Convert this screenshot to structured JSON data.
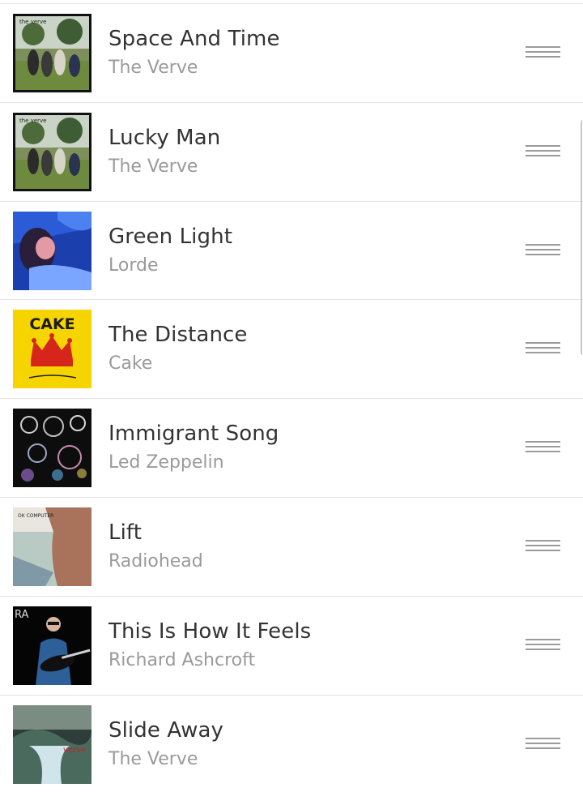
{
  "playlist": {
    "tracks": [
      {
        "title": "Space And Time",
        "artist": "The Verve",
        "cover": "urban-hymns",
        "cover_text": "the verve"
      },
      {
        "title": "Lucky Man",
        "artist": "The Verve",
        "cover": "urban-hymns",
        "cover_text": "the verve"
      },
      {
        "title": "Green Light",
        "artist": "Lorde",
        "cover": "melodrama",
        "cover_text": ""
      },
      {
        "title": "The Distance",
        "artist": "Cake",
        "cover": "fashion-nugget",
        "cover_text": "CAKE"
      },
      {
        "title": "Immigrant Song",
        "artist": "Led Zeppelin",
        "cover": "led-zeppelin-iii",
        "cover_text": ""
      },
      {
        "title": "Lift",
        "artist": "Radiohead",
        "cover": "ok-computer",
        "cover_text": "OK COMPUTER"
      },
      {
        "title": "This Is How It Feels",
        "artist": "Richard Ashcroft",
        "cover": "richard-ashcroft",
        "cover_text": "RA"
      },
      {
        "title": "Slide Away",
        "artist": "The Verve",
        "cover": "a-storm-in-heaven",
        "cover_text": "verve"
      }
    ],
    "drag_handle_icon": "drag-handle-icon"
  },
  "colors": {
    "title": "#333333",
    "artist": "#9a9a9a",
    "divider": "#e3e3e3",
    "handle": "#9b9b9b"
  }
}
